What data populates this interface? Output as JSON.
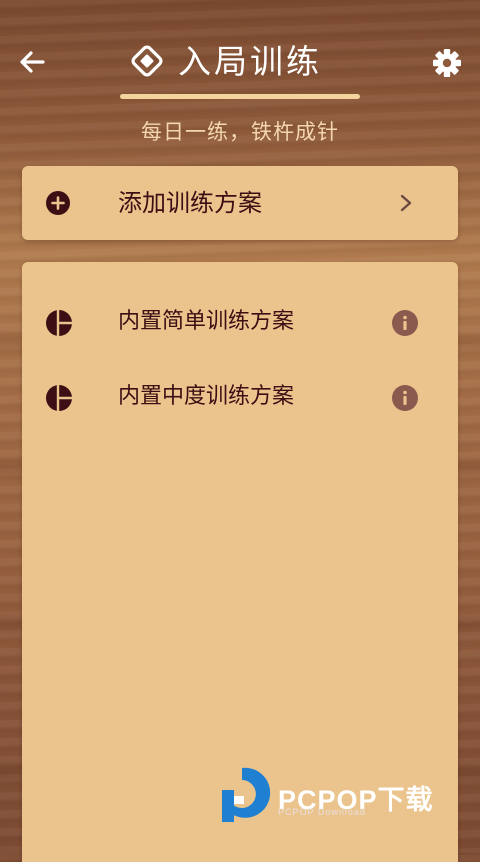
{
  "header": {
    "title": "入局训练",
    "subtitle": "每日一练，铁杵成针",
    "back_icon": "arrow-left-icon",
    "settings_icon": "gear-icon",
    "title_icon": "diamond-icon"
  },
  "add_plan": {
    "label": "添加训练方案",
    "icon": "plus-circle-icon",
    "chevron": "chevron-right-icon"
  },
  "plans": [
    {
      "label": "内置简单训练方案",
      "icon": "pie-icon",
      "info_icon": "info-icon"
    },
    {
      "label": "内置中度训练方案",
      "icon": "pie-icon",
      "info_icon": "info-icon"
    }
  ],
  "watermark": {
    "text": "PCPOP下载",
    "subtext": "PCPOP Download"
  },
  "colors": {
    "card": "#ebc48d",
    "text_dark": "#3b0f14",
    "info": "#8a5a4e",
    "underline": "#f3d49c",
    "subtitle": "#f4d7b0"
  }
}
